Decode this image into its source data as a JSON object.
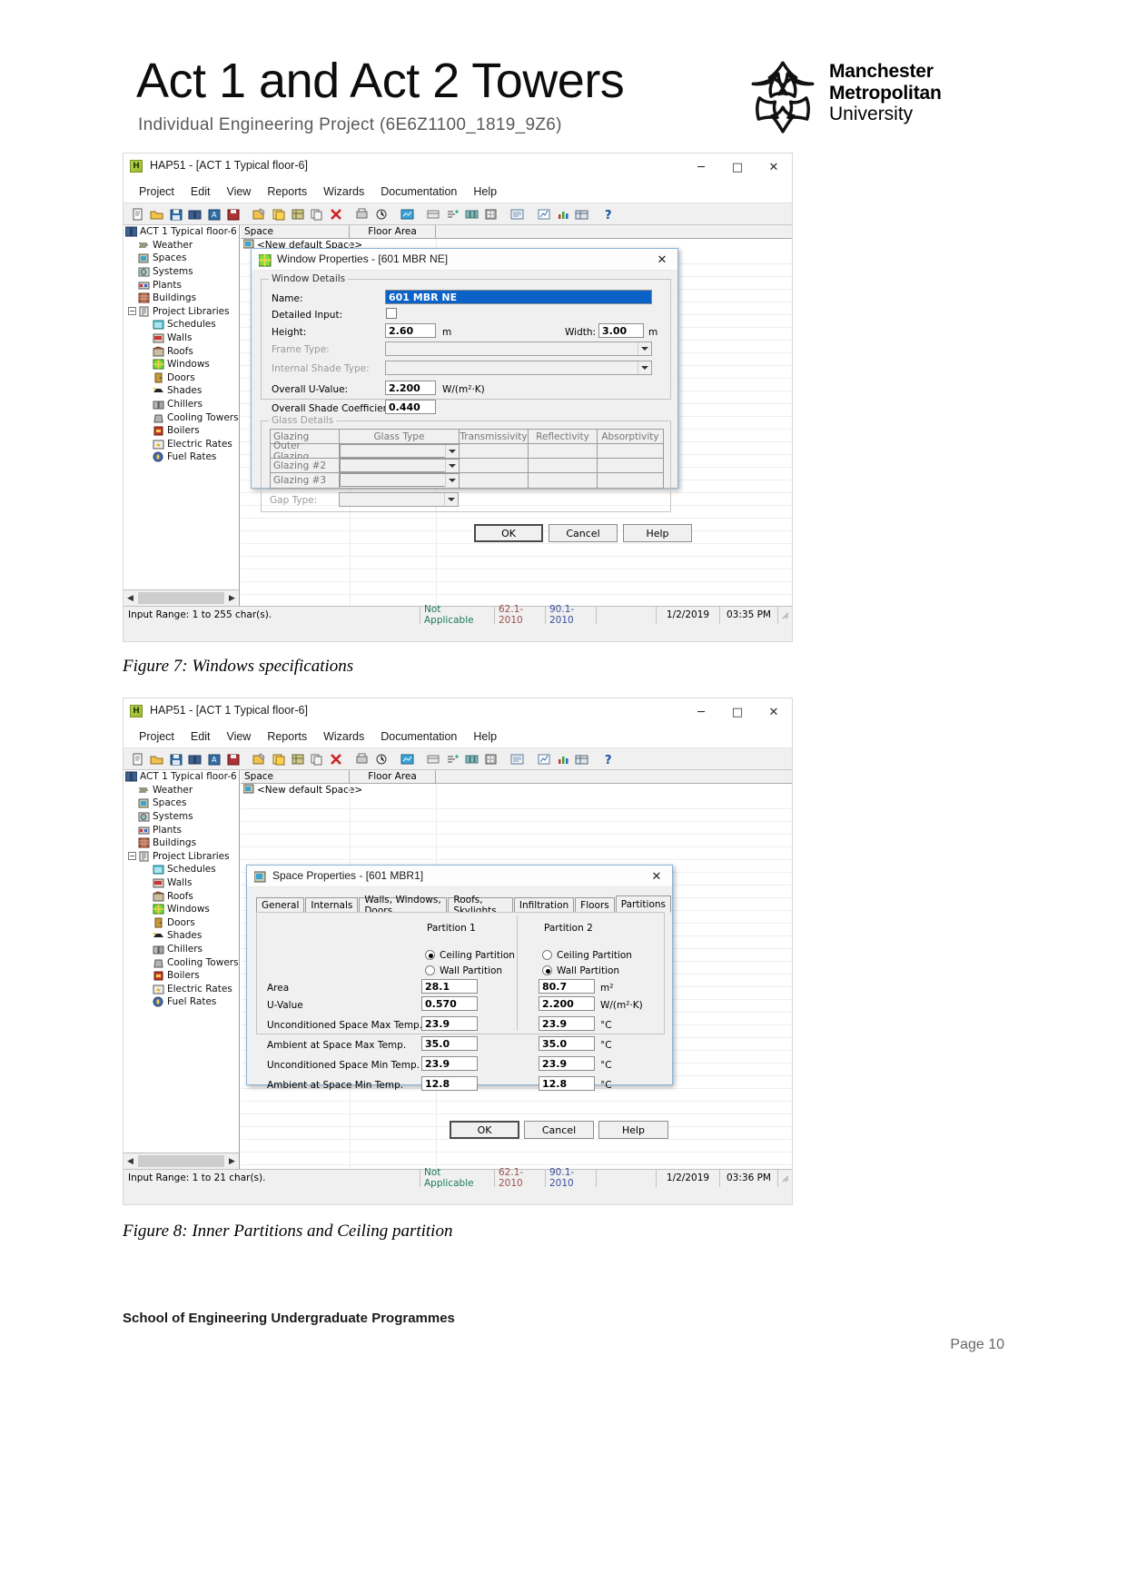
{
  "header": {
    "title": "Act 1 and Act 2 Towers",
    "subtitle": "Individual Engineering Project (6E6Z1100_1819_9Z6)",
    "logo": {
      "line1": "Manchester",
      "line2": "Metropolitan",
      "line3": "University"
    }
  },
  "app": {
    "title": "HAP51 - [ACT 1 Typical floor-6]",
    "menu": [
      "Project",
      "Edit",
      "View",
      "Reports",
      "Wizards",
      "Documentation",
      "Help"
    ],
    "window_buttons": {
      "minimize": "─",
      "maximize": "□",
      "close": "✕"
    },
    "tree_root": "ACT 1 Typical floor-6",
    "tree": [
      {
        "label": "Weather",
        "level": 1
      },
      {
        "label": "Spaces",
        "level": 1
      },
      {
        "label": "Systems",
        "level": 1
      },
      {
        "label": "Plants",
        "level": 1
      },
      {
        "label": "Buildings",
        "level": 1
      },
      {
        "label": "Project Libraries",
        "level": 1
      },
      {
        "label": "Schedules",
        "level": 2
      },
      {
        "label": "Walls",
        "level": 2
      },
      {
        "label": "Roofs",
        "level": 2
      },
      {
        "label": "Windows",
        "level": 2
      },
      {
        "label": "Doors",
        "level": 2
      },
      {
        "label": "Shades",
        "level": 2
      },
      {
        "label": "Chillers",
        "level": 2
      },
      {
        "label": "Cooling Towers",
        "level": 2
      },
      {
        "label": "Boilers",
        "level": 2
      },
      {
        "label": "Electric Rates",
        "level": 2
      },
      {
        "label": "Fuel Rates",
        "level": 2
      }
    ],
    "list_columns": [
      "Space",
      "Floor Area"
    ],
    "list_first_row": "<New default Space>"
  },
  "shot1": {
    "status": {
      "message": "Input Range: 1 to 255 char(s).",
      "not_applicable": "Not Applicable",
      "standard1": "62.1-2010",
      "standard2": "90.1-2010",
      "date": "1/2/2019",
      "time": "03:35 PM"
    },
    "dialog": {
      "title": "Window Properties - [601 MBR NE]",
      "close": "✕",
      "group_window_details": "Window Details",
      "labels": {
        "name": "Name:",
        "detailed_input": "Detailed Input:",
        "height": "Height:",
        "height_unit": "m",
        "width": "Width:",
        "width_unit": "m",
        "frame_type": "Frame Type:",
        "internal_shade_type": "Internal Shade Type:",
        "overall_u_value": "Overall U-Value:",
        "u_unit": "W/(m²·K)",
        "overall_shade_coefficient": "Overall Shade Coefficient:"
      },
      "values": {
        "name": "601 MBR NE",
        "height": "2.60",
        "width": "3.00",
        "frame_type": "",
        "internal_shade_type": "",
        "overall_u_value": "2.200",
        "overall_shade_coefficient": "0.440"
      },
      "group_glass_details": "Glass Details",
      "glass_table": {
        "columns": [
          "Glazing",
          "Glass Type",
          "Transmissivity",
          "Reflectivity",
          "Absorptivity"
        ],
        "rows": [
          {
            "glazing": "Outer Glazing",
            "glass_type": "",
            "transmissivity": "",
            "reflectivity": "",
            "absorptivity": ""
          },
          {
            "glazing": "Glazing #2",
            "glass_type": "",
            "transmissivity": "",
            "reflectivity": "",
            "absorptivity": ""
          },
          {
            "glazing": "Glazing #3",
            "glass_type": "",
            "transmissivity": "",
            "reflectivity": "",
            "absorptivity": ""
          }
        ]
      },
      "gap_type_label": "Gap Type:",
      "gap_type_value": "",
      "buttons": {
        "ok": "OK",
        "cancel": "Cancel",
        "help": "Help"
      }
    }
  },
  "shot2": {
    "status": {
      "message": "Input Range: 1 to 21 char(s).",
      "not_applicable": "Not Applicable",
      "standard1": "62.1-2010",
      "standard2": "90.1-2010",
      "date": "1/2/2019",
      "time": "03:36 PM"
    },
    "dialog": {
      "title": "Space Properties - [601 MBR1]",
      "close": "✕",
      "tabs": [
        "General",
        "Internals",
        "Walls, Windows, Doors",
        "Roofs, Skylights",
        "Infiltration",
        "Floors",
        "Partitions"
      ],
      "active_tab": "Partitions",
      "partition1_header": "Partition 1",
      "partition2_header": "Partition 2",
      "radio_ceiling": "Ceiling Partition",
      "radio_wall": "Wall Partition",
      "rows": [
        {
          "label": "Area",
          "p1": "28.1",
          "p2": "80.7",
          "unit": "m²"
        },
        {
          "label": "U-Value",
          "p1": "0.570",
          "p2": "2.200",
          "unit": "W/(m²·K)"
        },
        {
          "label": "Unconditioned Space Max Temp.",
          "p1": "23.9",
          "p2": "23.9",
          "unit": "°C"
        },
        {
          "label": "Ambient at Space Max Temp.",
          "p1": "35.0",
          "p2": "35.0",
          "unit": "°C"
        },
        {
          "label": "Unconditioned Space Min Temp.",
          "p1": "23.9",
          "p2": "23.9",
          "unit": "°C"
        },
        {
          "label": "Ambient at Space Min Temp.",
          "p1": "12.8",
          "p2": "12.8",
          "unit": "°C"
        }
      ],
      "p1_selected": "Ceiling Partition",
      "p2_selected": "Wall Partition",
      "buttons": {
        "ok": "OK",
        "cancel": "Cancel",
        "help": "Help"
      }
    }
  },
  "captions": {
    "figure7": "Figure 7: Windows specifications",
    "figure8": "Figure 8: Inner Partitions and Ceiling partition"
  },
  "footer": {
    "school": "School of Engineering Undergraduate Programmes",
    "page": "Page 10"
  }
}
